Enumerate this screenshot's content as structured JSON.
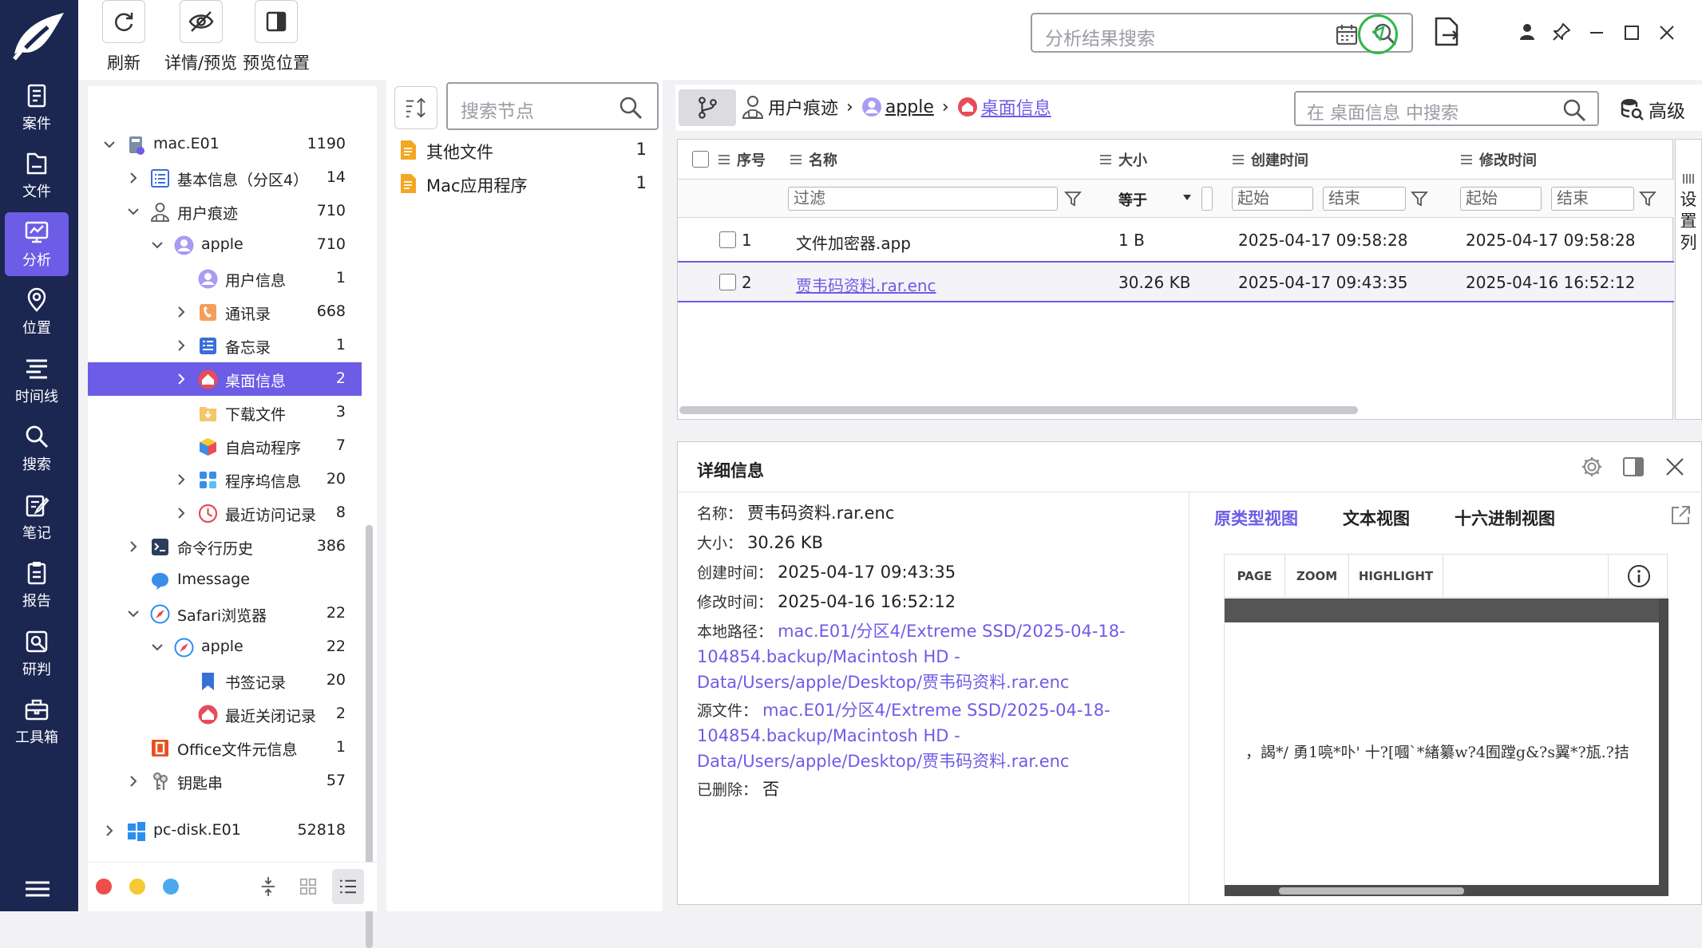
{
  "colors": {
    "accent": "#6d5ce6",
    "nav_bg": "#1b2651",
    "green": "#2fb84c"
  },
  "nav": [
    {
      "label": "案件",
      "icon": "case-icon"
    },
    {
      "label": "文件",
      "icon": "file-icon"
    },
    {
      "label": "分析",
      "icon": "analysis-icon",
      "active": true
    },
    {
      "label": "位置",
      "icon": "location-icon"
    },
    {
      "label": "时间线",
      "icon": "timeline-icon"
    },
    {
      "label": "搜索",
      "icon": "search-icon"
    },
    {
      "label": "笔记",
      "icon": "note-icon"
    },
    {
      "label": "报告",
      "icon": "report-icon"
    },
    {
      "label": "研判",
      "icon": "judge-icon"
    },
    {
      "label": "工具箱",
      "icon": "toolbox-icon"
    }
  ],
  "toolbar": {
    "refresh": "刷新",
    "detail_preview": "详情/预览",
    "preview_position": "预览位置"
  },
  "top_search": {
    "placeholder": "分析结果搜索"
  },
  "tree": [
    {
      "label": "mac.E01",
      "count": "1190",
      "depth": 0,
      "chev": "down",
      "icon": "disk-icon"
    },
    {
      "label": "基本信息（分区4）",
      "count": "14",
      "depth": 1,
      "chev": "right",
      "icon": "list-icon"
    },
    {
      "label": "用户痕迹",
      "count": "710",
      "depth": 1,
      "chev": "down",
      "icon": "user-trace-icon"
    },
    {
      "label": "apple",
      "count": "710",
      "depth": 2,
      "chev": "down",
      "icon": "user-icon"
    },
    {
      "label": "用户信息",
      "count": "1",
      "depth": 3,
      "chev": "",
      "icon": "user-icon"
    },
    {
      "label": "通讯录",
      "count": "668",
      "depth": 3,
      "chev": "right",
      "icon": "contacts-icon"
    },
    {
      "label": "备忘录",
      "count": "1",
      "depth": 3,
      "chev": "right",
      "icon": "memo-icon"
    },
    {
      "label": "桌面信息",
      "count": "2",
      "depth": 3,
      "chev": "right",
      "icon": "desktop-icon",
      "selected": true
    },
    {
      "label": "下载文件",
      "count": "3",
      "depth": 3,
      "chev": "",
      "icon": "download-icon"
    },
    {
      "label": "自启动程序",
      "count": "7",
      "depth": 3,
      "chev": "",
      "icon": "cube-icon"
    },
    {
      "label": "程序坞信息",
      "count": "20",
      "depth": 3,
      "chev": "right",
      "icon": "dock-icon"
    },
    {
      "label": "最近访问记录",
      "count": "8",
      "depth": 3,
      "chev": "right",
      "icon": "clock-icon"
    },
    {
      "label": "命令行历史",
      "count": "386",
      "depth": 1,
      "chev": "right",
      "icon": "terminal-icon"
    },
    {
      "label": "Imessage",
      "count": "",
      "depth": 1,
      "chev": "",
      "icon": "message-icon"
    },
    {
      "label": "Safari浏览器",
      "count": "22",
      "depth": 1,
      "chev": "down",
      "icon": "safari-icon"
    },
    {
      "label": "apple",
      "count": "22",
      "depth": 2,
      "chev": "down",
      "icon": "safari-icon"
    },
    {
      "label": "书签记录",
      "count": "20",
      "depth": 3,
      "chev": "",
      "icon": "bookmark-icon"
    },
    {
      "label": "最近关闭记录",
      "count": "2",
      "depth": 3,
      "chev": "",
      "icon": "desktop-icon"
    },
    {
      "label": "Office文件元信息",
      "count": "1",
      "depth": 1,
      "chev": "",
      "icon": "office-icon"
    },
    {
      "label": "钥匙串",
      "count": "57",
      "depth": 1,
      "chev": "right",
      "icon": "keychain-icon"
    },
    {
      "label": "pc-disk.E01",
      "count": "52818",
      "depth": 0,
      "chev": "right",
      "icon": "windows-icon",
      "gap": true
    }
  ],
  "node_search": {
    "placeholder": "搜索节点"
  },
  "nodes": [
    {
      "label": "其他文件",
      "count": "1"
    },
    {
      "label": "Mac应用程序",
      "count": "1"
    }
  ],
  "breadcrumb": {
    "b1": "用户痕迹",
    "b2": "apple",
    "b3": "桌面信息",
    "sep": "›"
  },
  "table_search": {
    "placeholder": "在 桌面信息 中搜索"
  },
  "advanced": "高级",
  "table": {
    "columns": {
      "index": "序号",
      "name": "名称",
      "size": "大小",
      "created": "创建时间",
      "modified": "修改时间"
    },
    "filter": {
      "text": "过滤",
      "op": "等于",
      "start": "起始",
      "end": "结束"
    },
    "rows": [
      {
        "index": "1",
        "name": "文件加密器.app",
        "size": "1 B",
        "created": "2025-04-17 09:58:28",
        "modified": "2025-04-17 09:58:28"
      },
      {
        "index": "2",
        "name": "贾韦码资料.rar.enc",
        "size": "30.26 KB",
        "created": "2025-04-17 09:43:35",
        "modified": "2025-04-16 16:52:12",
        "selected": true
      }
    ]
  },
  "settings_col": [
    "设",
    "置",
    "列"
  ],
  "detail": {
    "title": "详细信息",
    "name_k": "名称：",
    "name_v": "贾韦码资料.rar.enc",
    "size_k": "大小：",
    "size_v": "30.26 KB",
    "created_k": "创建时间：",
    "created_v": "2025-04-17 09:43:35",
    "modified_k": "修改时间：",
    "modified_v": "2025-04-16 16:52:12",
    "local_k": "本地路径：",
    "local_l1": "mac.E01/分区4/Extreme SSD/2025-04-18-",
    "local_l2": "104854.backup/Macintosh HD -",
    "local_l3": "Data/Users/apple/Desktop/贾韦码资料.rar.enc",
    "source_k": "源文件：",
    "source_l1": "mac.E01/分区4/Extreme SSD/2025-04-18-",
    "source_l2": "104854.backup/Macintosh HD -",
    "source_l3": "Data/Users/apple/Desktop/贾韦码资料.rar.enc",
    "deleted_k": "已删除：",
    "deleted_v": "否"
  },
  "view_tabs": {
    "native": "原类型视图",
    "text": "文本视图",
    "hex": "十六进制视图"
  },
  "viewer": {
    "page": "PAGE",
    "zoom": "ZOOM",
    "highlight": "HIGHLIGHT",
    "content": "，謁*/ 勇1喨*卟' 十?[嘓`*緖纂w?4囿蹚g&?s翼*?瓬.?拮"
  }
}
